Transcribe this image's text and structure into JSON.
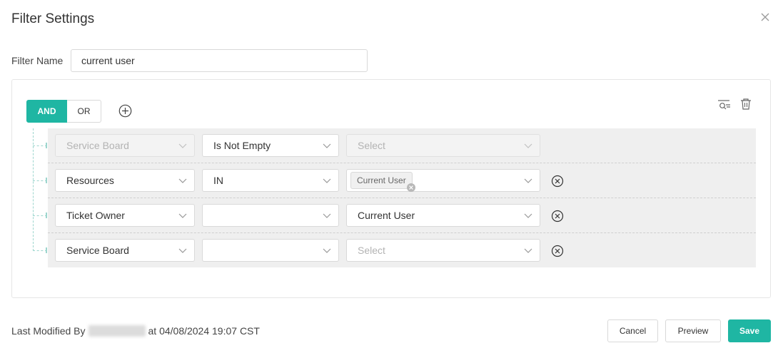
{
  "dialog": {
    "title": "Filter Settings"
  },
  "filter_name": {
    "label": "Filter Name",
    "value": "current user"
  },
  "logic": {
    "and_label": "AND",
    "or_label": "OR",
    "active": "AND"
  },
  "rows": [
    {
      "field": "Service Board",
      "operator": "Is Not Empty",
      "value": "Select",
      "value_is_placeholder": true,
      "disabled": true
    },
    {
      "field": "Resources",
      "operator": "IN",
      "value_tag": "Current User"
    },
    {
      "field": "Ticket Owner",
      "operator": "",
      "value": "Current User"
    },
    {
      "field": "Service Board",
      "operator": "",
      "value": "Select",
      "value_is_placeholder": true
    }
  ],
  "footer": {
    "modified_prefix": "Last Modified By",
    "modified_suffix": "at 04/08/2024 19:07 CST",
    "cancel_label": "Cancel",
    "preview_label": "Preview",
    "save_label": "Save"
  },
  "colors": {
    "accent": "#1fb6a3",
    "row_bg": "#efefef",
    "tree_line": "#9dd6ce"
  },
  "icons": [
    "close-icon",
    "add-circle-icon",
    "filter-search-icon",
    "trash-icon",
    "chevron-down-icon",
    "remove-circle-icon",
    "tag-remove-icon"
  ]
}
